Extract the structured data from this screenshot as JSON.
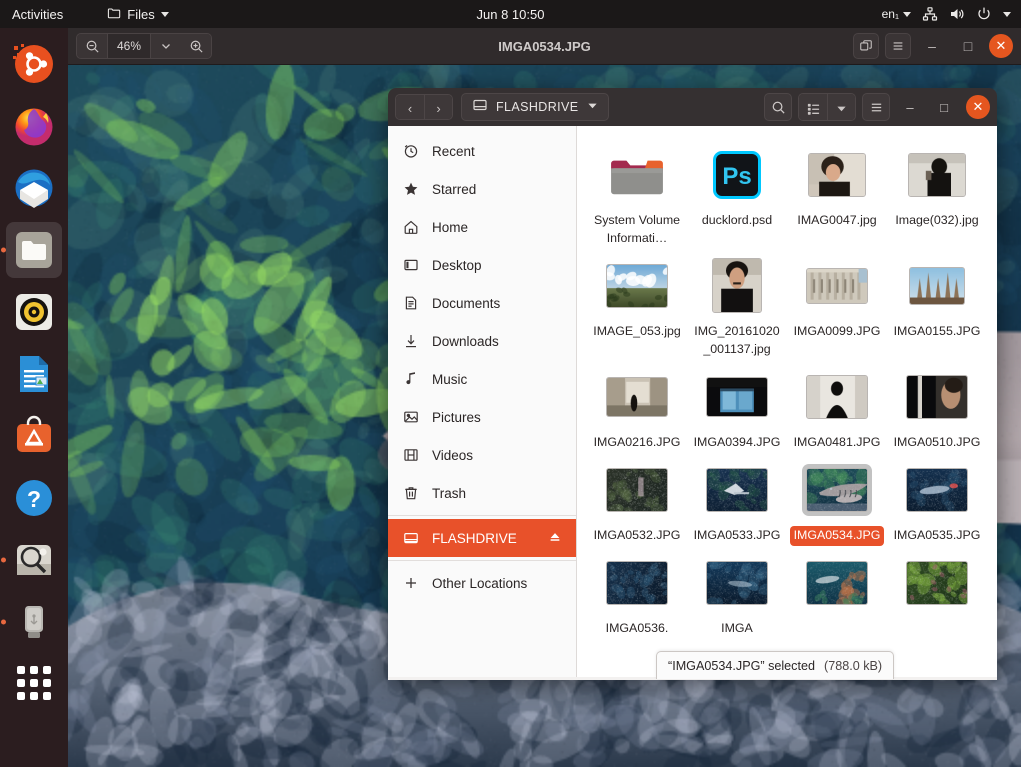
{
  "topbar": {
    "activities": "Activities",
    "app_menu": "Files",
    "app_icon": "folder-icon",
    "clock": "Jun 8  10:50",
    "language": "en₁",
    "icons": [
      "network-icon",
      "volume-icon",
      "power-icon",
      "chevron-down-icon"
    ]
  },
  "dock": {
    "items": [
      {
        "name": "ubuntu-software-logo",
        "label": "Ubuntu",
        "active": false,
        "running": false
      },
      {
        "name": "firefox",
        "label": "Firefox",
        "active": false,
        "running": false
      },
      {
        "name": "thunderbird",
        "label": "Thunderbird",
        "active": false,
        "running": false
      },
      {
        "name": "files",
        "label": "Files",
        "active": true,
        "running": true
      },
      {
        "name": "rhythmbox",
        "label": "Rhythmbox",
        "active": false,
        "running": false
      },
      {
        "name": "libreoffice-writer",
        "label": "LibreOffice Writer",
        "active": false,
        "running": false
      },
      {
        "name": "ubuntu-software",
        "label": "Ubuntu Software",
        "active": false,
        "running": false
      },
      {
        "name": "help",
        "label": "Help",
        "active": false,
        "running": false
      },
      {
        "name": "image-viewer",
        "label": "Image Viewer",
        "active": false,
        "running": true
      },
      {
        "name": "flashdrive",
        "label": "FLASHDRIVE",
        "active": false,
        "running": true
      }
    ],
    "show_apps_label": "Show Applications"
  },
  "viewer": {
    "title": "IMGA0534.JPG",
    "zoom_level": "46%",
    "zoom_out_icon": "zoom-out-icon",
    "zoom_in_icon": "zoom-in-icon",
    "zoom_dropdown_icon": "chevron-down-icon",
    "fullscreen_icon": "fullscreen-icon",
    "menu_icon": "hamburger-menu-icon",
    "minimize_label": "–",
    "maximize_label": "□",
    "close_label": "✕"
  },
  "nautilus": {
    "back_label": "‹",
    "forward_label": "›",
    "location": "FLASHDRIVE",
    "location_icon": "drive-icon",
    "location_dropdown_icon": "chevron-down-icon",
    "search_icon": "search-icon",
    "view_list_icon": "list-view-icon",
    "view_dropdown_icon": "chevron-down-icon",
    "menu_icon": "hamburger-menu-icon",
    "minimize_label": "–",
    "maximize_label": "□",
    "close_label": "✕",
    "sidebar": [
      {
        "label": "Recent",
        "icon": "clock-icon",
        "selected": false
      },
      {
        "label": "Starred",
        "icon": "star-icon",
        "selected": false
      },
      {
        "label": "Home",
        "icon": "home-icon",
        "selected": false
      },
      {
        "label": "Desktop",
        "icon": "desktop-icon",
        "selected": false
      },
      {
        "label": "Documents",
        "icon": "document-icon",
        "selected": false
      },
      {
        "label": "Downloads",
        "icon": "download-icon",
        "selected": false
      },
      {
        "label": "Music",
        "icon": "music-note-icon",
        "selected": false
      },
      {
        "label": "Pictures",
        "icon": "picture-icon",
        "selected": false
      },
      {
        "label": "Videos",
        "icon": "film-icon",
        "selected": false
      },
      {
        "label": "Trash",
        "icon": "trash-icon",
        "selected": false
      },
      {
        "label": "FLASHDRIVE",
        "icon": "drive-icon",
        "selected": true,
        "eject": true
      },
      {
        "label": "Other Locations",
        "icon": "plus-icon",
        "selected": false
      }
    ],
    "files": [
      {
        "name": "System Volume Informati…",
        "type": "folder",
        "selected": false
      },
      {
        "name": "ducklord.psd",
        "type": "psd",
        "selected": false
      },
      {
        "name": "IMAG0047.jpg",
        "type": "image",
        "selected": false,
        "thumb": "portrait-man-webcam"
      },
      {
        "name": "Image(032).jpg",
        "type": "image",
        "selected": false,
        "thumb": "person-dark-room"
      },
      {
        "name": "IMAGE_053.jpg",
        "type": "image",
        "selected": false,
        "thumb": "landscape-clouds"
      },
      {
        "name": "IMG_20161020_001137.jpg",
        "type": "image",
        "selected": false,
        "thumb": "portrait-man-dark"
      },
      {
        "name": "IMGA0099.JPG",
        "type": "image",
        "selected": false,
        "thumb": "building-facade"
      },
      {
        "name": "IMGA0155.JPG",
        "type": "image",
        "selected": false,
        "thumb": "sagrada-familia"
      },
      {
        "name": "IMGA0216.JPG",
        "type": "image",
        "selected": false,
        "thumb": "narrow-street"
      },
      {
        "name": "IMGA0394.JPG",
        "type": "image",
        "selected": false,
        "thumb": "dark-window"
      },
      {
        "name": "IMGA0481.JPG",
        "type": "image",
        "selected": false,
        "thumb": "silhouette-white-wall"
      },
      {
        "name": "IMGA0510.JPG",
        "type": "image",
        "selected": false,
        "thumb": "dark-person-stripe"
      },
      {
        "name": "IMGA0532.JPG",
        "type": "image",
        "selected": false,
        "thumb": "aquarium-dark"
      },
      {
        "name": "IMGA0533.JPG",
        "type": "image",
        "selected": false,
        "thumb": "aquarium-ray"
      },
      {
        "name": "IMGA0534.JPG",
        "type": "image",
        "selected": true,
        "thumb": "aquarium-shark"
      },
      {
        "name": "IMGA0535.JPG",
        "type": "image",
        "selected": false,
        "thumb": "aquarium-blue-fish"
      },
      {
        "name": "IMGA0536.",
        "type": "image",
        "selected": false,
        "thumb": "aquarium-blue-dark"
      },
      {
        "name": "IMGA",
        "type": "image",
        "selected": false,
        "thumb": "aquarium-blue-dark2"
      },
      {
        "name": "",
        "type": "image",
        "selected": false,
        "thumb": "aquarium-reef"
      },
      {
        "name": "",
        "type": "image",
        "selected": false,
        "thumb": "green-plants"
      }
    ],
    "status": {
      "selection_text": "“IMGA0534.JPG” selected",
      "size_text": "(788.0 kB)"
    }
  },
  "colors": {
    "accent_orange": "#e8512a",
    "close_button": "#e5561f",
    "topbar_bg": "#1b1818",
    "dock_bg": "#2b1d1f",
    "headerbar_bg": "#353031",
    "sidebar_bg": "#fafafa"
  }
}
